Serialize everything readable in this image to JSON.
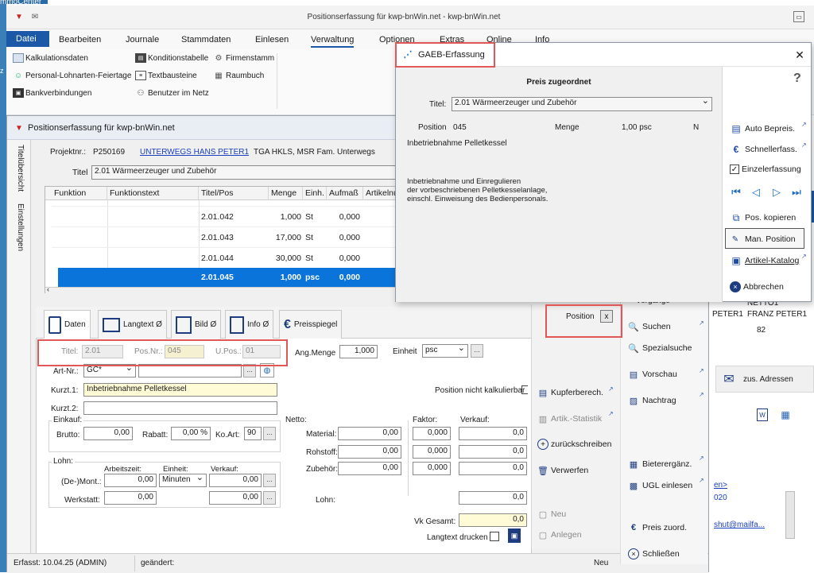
{
  "topbar": {
    "label": "mmoCenter"
  },
  "main_window": {
    "title": "Positionserfassung für kwp-bnWin.net - kwp-bnWin.net"
  },
  "ribbon": {
    "tabs": [
      "Datei",
      "Bearbeiten",
      "Journale",
      "Stammdaten",
      "Einlesen",
      "Verwaltung",
      "Optionen",
      "Extras",
      "Online",
      "Info"
    ],
    "items_col1": [
      "Kalkulationsdaten",
      "Personal-Lohnarten-Feiertage",
      "Bankverbindungen"
    ],
    "items_col2": [
      "Konditionstabelle",
      "Textbausteine",
      "Benutzer im Netz"
    ],
    "items_col3": [
      "Firmenstamm",
      "Raumbuch"
    ]
  },
  "inner_window": {
    "title": "Positionserfassung für kwp-bnWin.net",
    "side_tabs": [
      "Titelübersicht",
      "Einstellungen"
    ],
    "projekt_label": "Projektnr.:",
    "projekt_nr": "P250169",
    "projekt_link": "UNTERWEGS HANS PETER1",
    "projekt_desc": "TGA HKLS, MSR Fam. Unterwegs",
    "titel_label": "Titel",
    "titel_value": "2.01     Wärmeerzeuger und Zubehör",
    "table": {
      "headers": [
        "Funktion",
        "Funktionstext",
        "Titel/Pos",
        "Menge",
        "Einh.",
        "Aufmaß",
        "Artikelnu"
      ],
      "rows": [
        {
          "pos": "2.01.042",
          "menge": "1,000",
          "einh": "St",
          "aufmass": "0,000"
        },
        {
          "pos": "2.01.043",
          "menge": "17,000",
          "einh": "St",
          "aufmass": "0,000"
        },
        {
          "pos": "2.01.044",
          "menge": "30,000",
          "einh": "St",
          "aufmass": "0,000"
        },
        {
          "pos": "2.01.045",
          "menge": "1,000",
          "einh": "psc",
          "aufmass": "0,000"
        }
      ]
    },
    "tabs": [
      "Daten",
      "Langtext Ø",
      "Bild Ø",
      "Info Ø",
      "Preisspiegel"
    ],
    "form": {
      "titel_label": "Titel:",
      "titel": "2.01",
      "posnr_label": "Pos.Nr.:",
      "posnr": "045",
      "upos_label": "U.Pos.:",
      "upos": "01",
      "angmenge_label": "Ang.Menge",
      "angmenge": "1,000",
      "einheit_label": "Einheit",
      "einheit": "psc",
      "artnr_label": "Art-Nr.:",
      "artnr": "GC*",
      "kurzt1_label": "Kurzt.1:",
      "kurzt1": "Inbetriebnahme Pelletkessel",
      "kurzt2_label": "Kurzt.2:",
      "nicht_kalk": "Position nicht kalkulierbar",
      "einkauf_label": "Einkauf:",
      "brutto_label": "Brutto:",
      "brutto": "0,00",
      "rabatt_label": "Rabatt:",
      "rabatt": "0,00 %",
      "koart_label": "Ko.Art:",
      "koart": "90",
      "netto_label": "Netto:",
      "faktor_label": "Faktor:",
      "verkauf_label": "Verkauf:",
      "material_label": "Material:",
      "rohstoff_label": "Rohstoff:",
      "zubehoer_label": "Zubehör:",
      "netto_val": "0,00",
      "faktor_val": "0,000",
      "verkauf_val": "0,0",
      "lohn_label": "Lohn:",
      "arbeitszeit_label": "Arbeitszeit:",
      "einheit2_label": "Einheit:",
      "verkauf2_label": "Verkauf:",
      "demont_label": "(De-)Mont.:",
      "werkstatt_label": "Werkstatt:",
      "arbeitszeit": "0,00",
      "einheit2": "Minuten",
      "verkauf2": "0,00",
      "werkstatt": "0,00",
      "werkstatt_verkauf": "0,00",
      "lohn2_label": "Lohn:",
      "lohn_val": "0,0",
      "vkgesamt_label": "Vk Gesamt:",
      "vkgesamt": "0,0",
      "langtext_drucken": "Langtext drucken"
    },
    "statusbar": {
      "erfasst": "Erfasst: 10.04.25 (ADMIN)",
      "geaendert": "geändert:",
      "neu": "Neu"
    }
  },
  "middle_rail": {
    "position_label": "Position",
    "items": [
      "Kupferberech.",
      "Artik.-Statistik",
      "zurückschreiben",
      "Verwerfen",
      "Neu",
      "Anlegen"
    ]
  },
  "right_rail": {
    "vorgaenge": "Vorgänge",
    "items": [
      "Suchen",
      "Spezialsuche",
      "Vorschau",
      "Nachtrag",
      "Bieterergänz.",
      "UGL einlesen",
      "Preis zuord.",
      "Schließen"
    ],
    "netto_label": "NETTO1",
    "peter_a": "PETER1",
    "peter_b": "FRANZ PETER1",
    "num": "82",
    "zus_adressen": "zus. Adressen",
    "link1": "en>",
    "link2": "020",
    "link3": "shut@mailfa..."
  },
  "dialog": {
    "title": "GAEB-Erfassung",
    "heading": "Preis zugeordnet",
    "titel_label": "Titel:",
    "titel": "2.01     Wärmeerzeuger und Zubehör",
    "position_label": "Position",
    "position": "045",
    "menge_label": "Menge",
    "menge": "1,00 psc",
    "n": "N",
    "kurztext": "Inbetriebnahme Pelletkessel",
    "langtext": [
      "Inbetriebnahme und Einregulieren",
      "der vorbeschriebenen Pelletkesselanlage,",
      "einschl. Einweisung des Bedienpersonals."
    ],
    "help": "?",
    "buttons": [
      "Auto Bepreis.",
      "Schnellerfass.",
      "Einzelerfassung",
      "Pos. kopieren",
      "Man. Position",
      "Artikel-Katalog",
      "Abbrechen"
    ]
  },
  "colors": {
    "accent": "#1d6bbf",
    "selected_row": "#0a74da",
    "red_outline": "#e15757",
    "ribbon_file": "#1b58a8"
  }
}
